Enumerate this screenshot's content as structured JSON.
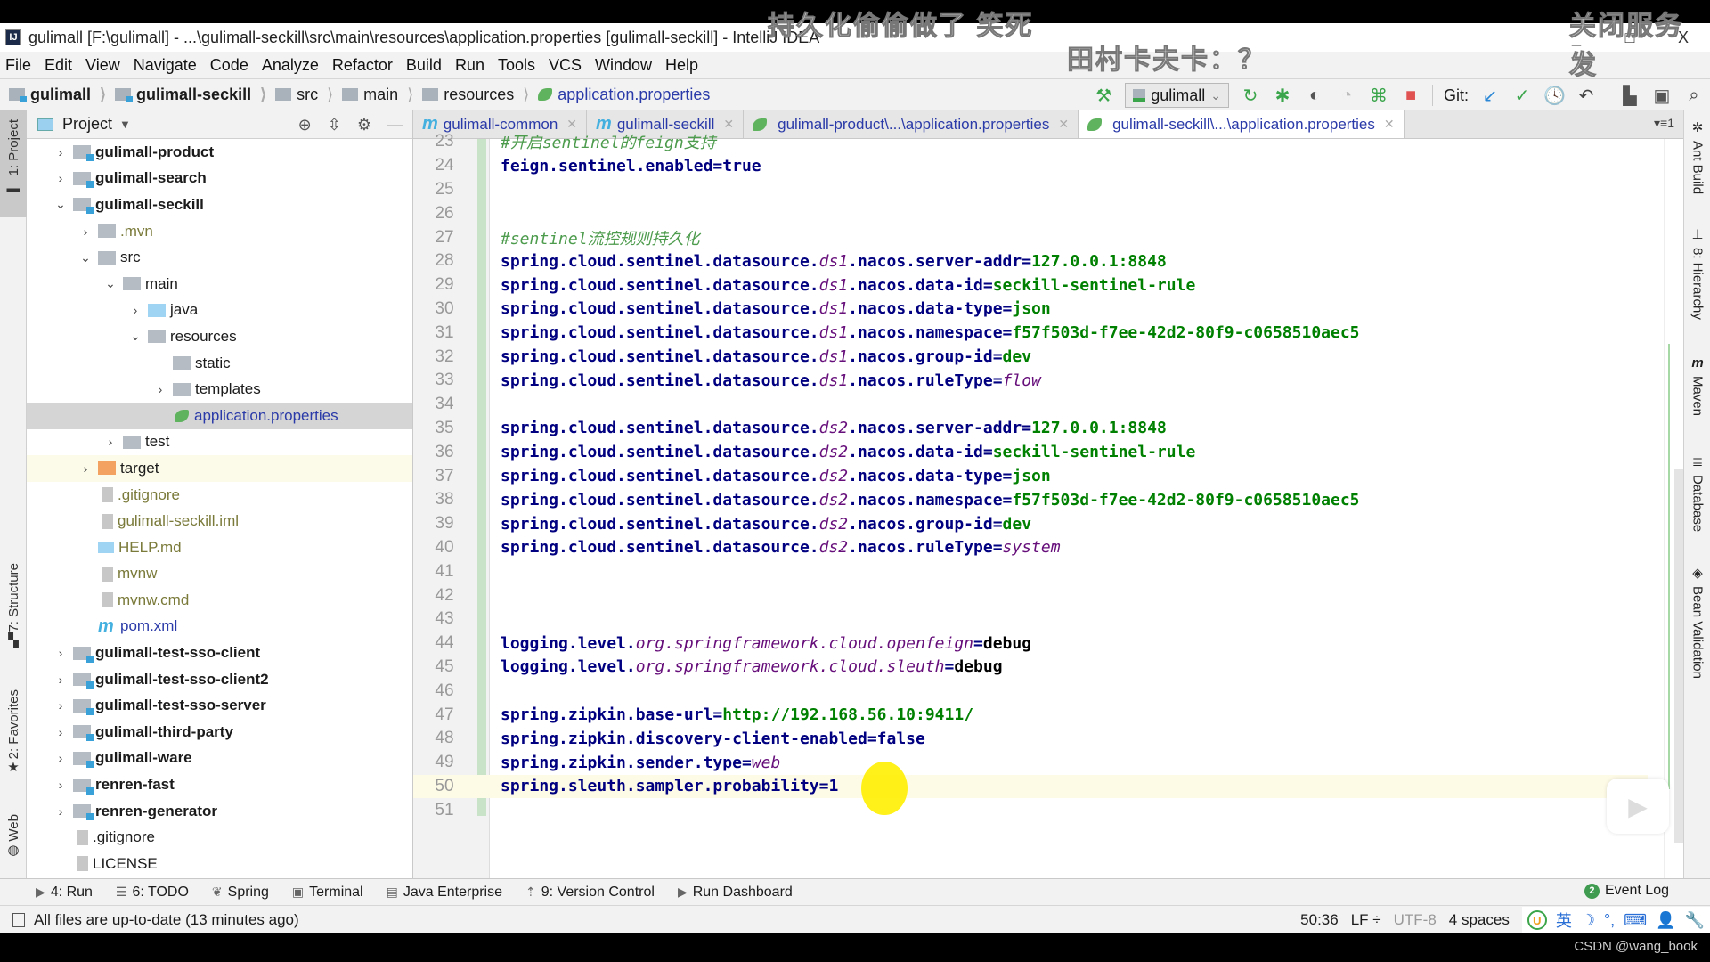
{
  "window": {
    "title": "gulimall [F:\\gulimall] - ...\\gulimall-seckill\\src\\main\\resources\\application.properties [gulimall-seckill] - IntelliJ IDEA",
    "logo": "IJ",
    "controls": {
      "minimize": "_",
      "maximize": "□",
      "close": "X"
    }
  },
  "overlays": {
    "danmaku": [
      "持久化偷偷做了  笑死",
      "关闭服务发",
      "田村卡夫卡：？"
    ],
    "watermark": "CSDN @wang_book",
    "play_icon": "tv-play-icon"
  },
  "menu": [
    "File",
    "Edit",
    "View",
    "Navigate",
    "Code",
    "Analyze",
    "Refactor",
    "Build",
    "Run",
    "Tools",
    "VCS",
    "Window",
    "Help"
  ],
  "breadcrumb": [
    {
      "label": "gulimall",
      "type": "module"
    },
    {
      "label": "gulimall-seckill",
      "type": "module"
    },
    {
      "label": "src",
      "type": "folder"
    },
    {
      "label": "main",
      "type": "folder"
    },
    {
      "label": "resources",
      "type": "resources-folder"
    },
    {
      "label": "application.properties",
      "type": "spring-file"
    }
  ],
  "toolbar": {
    "run_config": "gulimall",
    "git_label": "Git:",
    "icons": [
      "build-hammer-icon",
      "rerun-icon",
      "debug-icon",
      "coverage-icon",
      "profile-icon",
      "attach-debugger-icon",
      "stop-icon",
      "git-update-icon",
      "git-commit-icon",
      "history-icon",
      "rollback-icon",
      "project-structure-icon",
      "terminal-frame-icon",
      "search-icon"
    ]
  },
  "left_tool_tabs": [
    {
      "label": "1: Project",
      "icon": "folder-icon"
    },
    {
      "label": "7: Structure",
      "icon": "structure-icon"
    },
    {
      "label": "2: Favorites",
      "icon": "star-icon"
    },
    {
      "label": "Web",
      "icon": "globe-icon"
    }
  ],
  "right_tool_tabs": [
    {
      "label": "Ant Build",
      "icon": "ant-icon"
    },
    {
      "label": "8: Hierarchy",
      "icon": "hierarchy-icon"
    },
    {
      "label": "Maven",
      "icon": "maven-icon"
    },
    {
      "label": "Database",
      "icon": "database-icon"
    },
    {
      "label": "Bean Validation",
      "icon": "bean-validation-icon"
    }
  ],
  "project_panel": {
    "title": "Project",
    "tree": [
      {
        "label": "gulimall-product",
        "depth": 0,
        "arrow": ">",
        "icon": "module",
        "style": "bold"
      },
      {
        "label": "gulimall-search",
        "depth": 0,
        "arrow": ">",
        "icon": "module",
        "style": "bold"
      },
      {
        "label": "gulimall-seckill",
        "depth": 0,
        "arrow": "v",
        "icon": "module",
        "style": "bold"
      },
      {
        "label": ".mvn",
        "depth": 1,
        "arrow": ">",
        "icon": "folder",
        "style": "olive"
      },
      {
        "label": "src",
        "depth": 1,
        "arrow": "v",
        "icon": "folder",
        "style": ""
      },
      {
        "label": "main",
        "depth": 2,
        "arrow": "v",
        "icon": "folder",
        "style": ""
      },
      {
        "label": "java",
        "depth": 3,
        "arrow": ">",
        "icon": "src",
        "style": ""
      },
      {
        "label": "resources",
        "depth": 3,
        "arrow": "v",
        "icon": "folder",
        "style": ""
      },
      {
        "label": "static",
        "depth": 4,
        "arrow": "",
        "icon": "folder",
        "style": ""
      },
      {
        "label": "templates",
        "depth": 4,
        "arrow": ">",
        "icon": "folder",
        "style": ""
      },
      {
        "label": "application.properties",
        "depth": 4,
        "arrow": "",
        "icon": "spring",
        "style": "blue",
        "selected": true
      },
      {
        "label": "test",
        "depth": 2,
        "arrow": ">",
        "icon": "folder",
        "style": ""
      },
      {
        "label": "target",
        "depth": 1,
        "arrow": ">",
        "icon": "orange",
        "style": "",
        "excluded": true
      },
      {
        "label": ".gitignore",
        "depth": 1,
        "arrow": "",
        "icon": "file",
        "style": "olive"
      },
      {
        "label": "gulimall-seckill.iml",
        "depth": 1,
        "arrow": "",
        "icon": "file",
        "style": "olive"
      },
      {
        "label": "HELP.md",
        "depth": 1,
        "arrow": "",
        "icon": "md",
        "style": "olive"
      },
      {
        "label": "mvnw",
        "depth": 1,
        "arrow": "",
        "icon": "file",
        "style": "olive"
      },
      {
        "label": "mvnw.cmd",
        "depth": 1,
        "arrow": "",
        "icon": "file",
        "style": "olive"
      },
      {
        "label": "pom.xml",
        "depth": 1,
        "arrow": "",
        "icon": "mvn",
        "style": "blue"
      },
      {
        "label": "gulimall-test-sso-client",
        "depth": 0,
        "arrow": ">",
        "icon": "module",
        "style": "bold"
      },
      {
        "label": "gulimall-test-sso-client2",
        "depth": 0,
        "arrow": ">",
        "icon": "module",
        "style": "bold"
      },
      {
        "label": "gulimall-test-sso-server",
        "depth": 0,
        "arrow": ">",
        "icon": "module",
        "style": "bold"
      },
      {
        "label": "gulimall-third-party",
        "depth": 0,
        "arrow": ">",
        "icon": "module",
        "style": "bold"
      },
      {
        "label": "gulimall-ware",
        "depth": 0,
        "arrow": ">",
        "icon": "module",
        "style": "bold"
      },
      {
        "label": "renren-fast",
        "depth": 0,
        "arrow": ">",
        "icon": "module",
        "style": "bold"
      },
      {
        "label": "renren-generator",
        "depth": 0,
        "arrow": ">",
        "icon": "module",
        "style": "bold"
      },
      {
        "label": ".gitignore",
        "depth": 0,
        "arrow": "",
        "icon": "file",
        "style": ""
      },
      {
        "label": "LICENSE",
        "depth": 0,
        "arrow": "",
        "icon": "file",
        "style": ""
      }
    ]
  },
  "editor": {
    "tabs": [
      {
        "label": "gulimall-common",
        "icon": "maven",
        "active": false
      },
      {
        "label": "gulimall-seckill",
        "icon": "maven",
        "active": false
      },
      {
        "label": "gulimall-product\\...\\application.properties",
        "icon": "spring",
        "active": false
      },
      {
        "label": "gulimall-seckill\\...\\application.properties",
        "icon": "spring",
        "active": true
      }
    ],
    "tabs_menu": "▾≡1",
    "current_line": 50,
    "lines": [
      {
        "n": 23,
        "parts": [
          {
            "t": "#开启sentinel的feign支持",
            "c": "c"
          }
        ]
      },
      {
        "n": 24,
        "parts": [
          {
            "t": "feign.sentinel.enabled",
            "c": "k"
          },
          {
            "t": "=",
            "c": "k"
          },
          {
            "t": "true",
            "c": "k"
          }
        ]
      },
      {
        "n": 25,
        "parts": []
      },
      {
        "n": 26,
        "parts": []
      },
      {
        "n": 27,
        "parts": [
          {
            "t": "#sentinel流控规则持久化",
            "c": "c"
          }
        ]
      },
      {
        "n": 28,
        "parts": [
          {
            "t": "spring.cloud.sentinel.datasource.",
            "c": "k"
          },
          {
            "t": "ds1",
            "c": "i"
          },
          {
            "t": ".nacos.server-addr",
            "c": "k"
          },
          {
            "t": "=",
            "c": "k"
          },
          {
            "t": "127.0.0.1:8848",
            "c": "v"
          }
        ]
      },
      {
        "n": 29,
        "parts": [
          {
            "t": "spring.cloud.sentinel.datasource.",
            "c": "k"
          },
          {
            "t": "ds1",
            "c": "i"
          },
          {
            "t": ".nacos.data-id",
            "c": "k"
          },
          {
            "t": "=",
            "c": "k"
          },
          {
            "t": "seckill-sentinel-rule",
            "c": "v"
          }
        ]
      },
      {
        "n": 30,
        "parts": [
          {
            "t": "spring.cloud.sentinel.datasource.",
            "c": "k"
          },
          {
            "t": "ds1",
            "c": "i"
          },
          {
            "t": ".nacos.data-type",
            "c": "k"
          },
          {
            "t": "=",
            "c": "k"
          },
          {
            "t": "json",
            "c": "v"
          }
        ]
      },
      {
        "n": 31,
        "parts": [
          {
            "t": "spring.cloud.sentinel.datasource.",
            "c": "k"
          },
          {
            "t": "ds1",
            "c": "i"
          },
          {
            "t": ".nacos.namespace",
            "c": "k"
          },
          {
            "t": "=",
            "c": "k"
          },
          {
            "t": "f57f503d-f7ee-42d2-80f9-c0658510aec5",
            "c": "v"
          }
        ]
      },
      {
        "n": 32,
        "parts": [
          {
            "t": "spring.cloud.sentinel.datasource.",
            "c": "k"
          },
          {
            "t": "ds1",
            "c": "i"
          },
          {
            "t": ".nacos.group-id",
            "c": "k"
          },
          {
            "t": "=",
            "c": "k"
          },
          {
            "t": "dev",
            "c": "v"
          }
        ]
      },
      {
        "n": 33,
        "parts": [
          {
            "t": "spring.cloud.sentinel.datasource.",
            "c": "k"
          },
          {
            "t": "ds1",
            "c": "i"
          },
          {
            "t": ".nacos.ruleType",
            "c": "k"
          },
          {
            "t": "=",
            "c": "k"
          },
          {
            "t": "flow",
            "c": "iv"
          }
        ]
      },
      {
        "n": 34,
        "parts": []
      },
      {
        "n": 35,
        "parts": [
          {
            "t": "spring.cloud.sentinel.datasource.",
            "c": "k"
          },
          {
            "t": "ds2",
            "c": "i"
          },
          {
            "t": ".nacos.server-addr",
            "c": "k"
          },
          {
            "t": "=",
            "c": "k"
          },
          {
            "t": "127.0.0.1:8848",
            "c": "v"
          }
        ]
      },
      {
        "n": 36,
        "parts": [
          {
            "t": "spring.cloud.sentinel.datasource.",
            "c": "k"
          },
          {
            "t": "ds2",
            "c": "i"
          },
          {
            "t": ".nacos.data-id",
            "c": "k"
          },
          {
            "t": "=",
            "c": "k"
          },
          {
            "t": "seckill-sentinel-rule",
            "c": "v"
          }
        ]
      },
      {
        "n": 37,
        "parts": [
          {
            "t": "spring.cloud.sentinel.datasource.",
            "c": "k"
          },
          {
            "t": "ds2",
            "c": "i"
          },
          {
            "t": ".nacos.data-type",
            "c": "k"
          },
          {
            "t": "=",
            "c": "k"
          },
          {
            "t": "json",
            "c": "v"
          }
        ]
      },
      {
        "n": 38,
        "parts": [
          {
            "t": "spring.cloud.sentinel.datasource.",
            "c": "k"
          },
          {
            "t": "ds2",
            "c": "i"
          },
          {
            "t": ".nacos.namespace",
            "c": "k"
          },
          {
            "t": "=",
            "c": "k"
          },
          {
            "t": "f57f503d-f7ee-42d2-80f9-c0658510aec5",
            "c": "v"
          }
        ]
      },
      {
        "n": 39,
        "parts": [
          {
            "t": "spring.cloud.sentinel.datasource.",
            "c": "k"
          },
          {
            "t": "ds2",
            "c": "i"
          },
          {
            "t": ".nacos.group-id",
            "c": "k"
          },
          {
            "t": "=",
            "c": "k"
          },
          {
            "t": "dev",
            "c": "v"
          }
        ]
      },
      {
        "n": 40,
        "parts": [
          {
            "t": "spring.cloud.sentinel.datasource.",
            "c": "k"
          },
          {
            "t": "ds2",
            "c": "i"
          },
          {
            "t": ".nacos.ruleType",
            "c": "k"
          },
          {
            "t": "=",
            "c": "k"
          },
          {
            "t": "system",
            "c": "iv"
          }
        ]
      },
      {
        "n": 41,
        "parts": []
      },
      {
        "n": 42,
        "parts": []
      },
      {
        "n": 43,
        "parts": []
      },
      {
        "n": 44,
        "parts": [
          {
            "t": "logging.level.",
            "c": "k"
          },
          {
            "t": "org.springframework.cloud.openfeign",
            "c": "i"
          },
          {
            "t": "=",
            "c": "k"
          },
          {
            "t": "debug",
            "c": "plain"
          }
        ]
      },
      {
        "n": 45,
        "parts": [
          {
            "t": "logging.level.",
            "c": "k"
          },
          {
            "t": "org.springframework.cloud.sleuth",
            "c": "i"
          },
          {
            "t": "=",
            "c": "k"
          },
          {
            "t": "debug",
            "c": "plain"
          }
        ]
      },
      {
        "n": 46,
        "parts": []
      },
      {
        "n": 47,
        "parts": [
          {
            "t": "spring.zipkin.base-url",
            "c": "k"
          },
          {
            "t": "=",
            "c": "k"
          },
          {
            "t": "http://192.168.56.10:9411/",
            "c": "v"
          }
        ]
      },
      {
        "n": 48,
        "parts": [
          {
            "t": "spring.zipkin.discovery-client-enabled",
            "c": "k"
          },
          {
            "t": "=",
            "c": "k"
          },
          {
            "t": "false",
            "c": "k"
          }
        ]
      },
      {
        "n": 49,
        "parts": [
          {
            "t": "spring.zipkin.sender.type",
            "c": "k"
          },
          {
            "t": "=",
            "c": "k"
          },
          {
            "t": "web",
            "c": "iv"
          }
        ]
      },
      {
        "n": 50,
        "parts": [
          {
            "t": "spring.sleuth.sampler.probability",
            "c": "k"
          },
          {
            "t": "=",
            "c": "k"
          },
          {
            "t": "1",
            "c": "k"
          }
        ]
      },
      {
        "n": 51,
        "parts": []
      }
    ]
  },
  "bottom_tools": [
    {
      "label": "4: Run",
      "icon": "run-icon"
    },
    {
      "label": "6: TODO",
      "icon": "todo-icon"
    },
    {
      "label": "Spring",
      "icon": "spring-icon"
    },
    {
      "label": "Terminal",
      "icon": "terminal-icon"
    },
    {
      "label": "Java Enterprise",
      "icon": "java-enterprise-icon"
    },
    {
      "label": "9: Version Control",
      "icon": "version-control-icon"
    },
    {
      "label": "Run Dashboard",
      "icon": "run-dashboard-icon"
    }
  ],
  "event_log": {
    "label": "Event Log",
    "count": "2"
  },
  "status": {
    "message": "All files are up-to-date (13 minutes ago)",
    "position": "50:36",
    "line_sep": "LF ÷",
    "encoding": "UTF-8",
    "indent": "4 spaces",
    "ime": [
      "U",
      "英",
      "☽",
      "°,",
      "⌨",
      "👤",
      "🔧"
    ]
  }
}
